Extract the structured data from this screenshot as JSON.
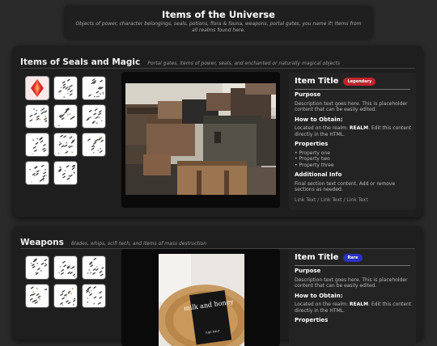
{
  "header": {
    "title": "Items of the Universe",
    "subtitle": "Objects of power, character belongings, seals, potions, flora & fauna, weapons, portal gates, you name it! Items from all realms found here."
  },
  "sections": [
    {
      "title": "Items of Seals and Magic",
      "subtitle": "Portal gates, items of power, seals, and enchanted or naturally magical objects",
      "grid_count": 11,
      "info": {
        "item_title": "Item Title",
        "badge": "Legendary",
        "purpose_heading": "Purpose",
        "purpose_text": "Description text goes here. This is placeholder content that can be easily edited.",
        "obtain_heading": "How to Obtain:",
        "obtain_prefix": "Located on the realm: ",
        "obtain_realm": "REALM",
        "obtain_suffix": ". Edit this content directly in the HTML.",
        "properties_heading": "Properties",
        "properties": [
          "Property one",
          "Property two",
          "Property three"
        ],
        "additional_heading": "Additional Info",
        "additional_text": "Final section text content. Add or remove sections as needed.",
        "links": [
          "Link Text",
          "Link Text",
          "Link Text"
        ]
      }
    },
    {
      "title": "Weapons",
      "subtitle": "Blades, whips, scifi tech, and items of mass destruction",
      "grid_count": 6,
      "book_title": "milk and honey",
      "book_author": "rupi kaur",
      "info": {
        "item_title": "Item Title",
        "badge": "Rare",
        "purpose_heading": "Purpose",
        "purpose_text": "Description text goes here. This is placeholder content that can be easily edited.",
        "obtain_heading": "How to Obtain:",
        "obtain_prefix": "Located on the realm: ",
        "obtain_realm": "REALM",
        "obtain_suffix": ". Edit this content directly in the HTML.",
        "properties_heading": "Properties"
      }
    }
  ],
  "colors": {
    "legendary": "#c0232b",
    "rare": "#2b2fc9",
    "panel": "#1e1e1e",
    "background": "#2a2a2a"
  }
}
